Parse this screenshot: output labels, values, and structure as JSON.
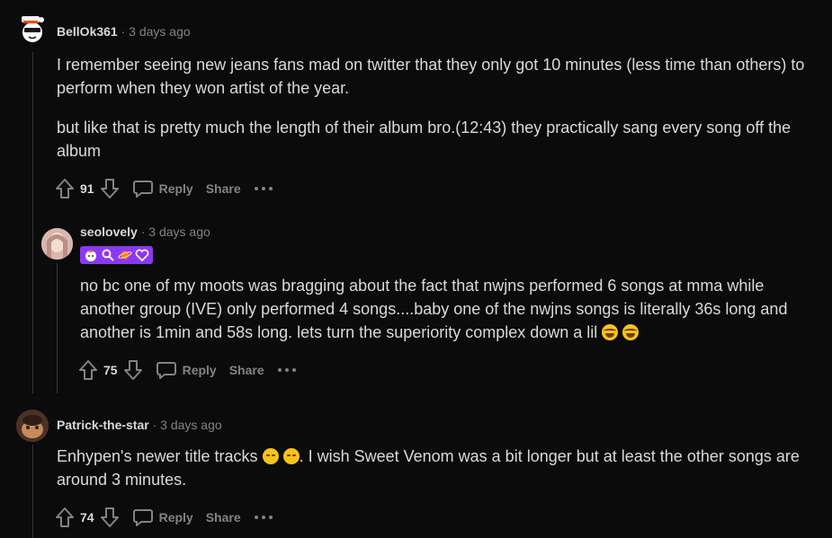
{
  "comments": [
    {
      "username": "BellOk361",
      "separator": "·",
      "time": "3 days ago",
      "paragraph1": "I remember seeing new jeans fans mad on twitter that they only got 10 minutes (less time than others) to perform when they won artist of the year.",
      "paragraph2": "but like that is pretty much the length of their album bro.(12:43) they practically sang every song off the album",
      "votes": "91",
      "reply_label": "Reply",
      "share_label": "Share"
    },
    {
      "username": "seolovely",
      "separator": "·",
      "time": "3 days ago",
      "flair_icons": [
        "flame-face-emoji",
        "magnifier-emoji",
        "planet-emoji",
        "purple-heart-emoji"
      ],
      "text": "no bc one of my moots was bragging about the fact that nwjns performed 6 songs at mma while another group (IVE) only performed 4 songs....baby one of the nwjns songs is literally 36s long and another is 1min and 58s long. lets turn the superiority complex down a lil",
      "votes": "75",
      "reply_label": "Reply",
      "share_label": "Share"
    },
    {
      "username": "Patrick-the-star",
      "separator": "·",
      "time": "3 days ago",
      "text_before": "Enhypen's newer title tracks",
      "text_after": ". I wish Sweet Venom was a bit longer but at least the other songs are around 3 minutes.",
      "votes": "74",
      "reply_label": "Reply",
      "share_label": "Share"
    }
  ],
  "colors": {
    "background": "#0b0b0b",
    "text": "#d7dadc",
    "muted": "#818384",
    "flair": "#8a38f5",
    "thread_line": "#343536"
  }
}
